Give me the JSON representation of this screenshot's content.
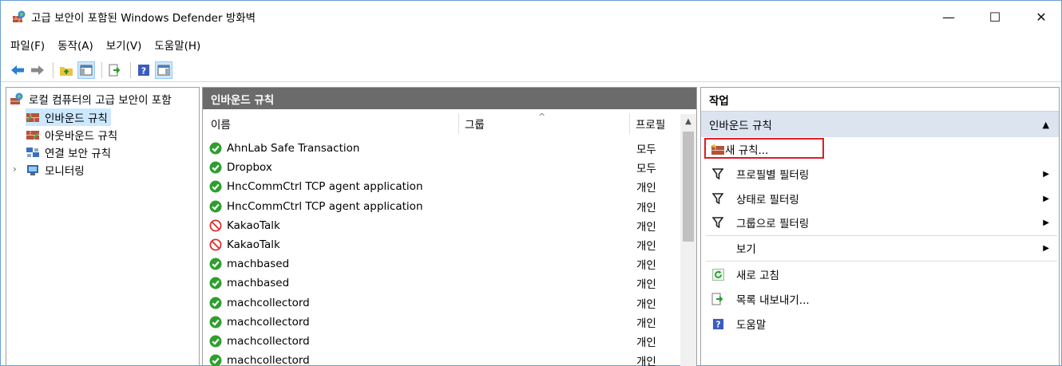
{
  "window": {
    "title": "고급 보안이 포함된 Windows Defender 방화벽",
    "minimize_glyph": "—",
    "maximize_glyph": "☐",
    "close_glyph": "✕"
  },
  "menu": {
    "items": [
      "파일(F)",
      "동작(A)",
      "보기(V)",
      "도움말(H)"
    ]
  },
  "toolbar": {
    "buttons": [
      "back-arrow-icon",
      "forward-arrow-icon",
      "up-folder-icon",
      "show-hide-tree-icon",
      "export-icon",
      "help-icon",
      "action-pane-icon"
    ]
  },
  "tree": {
    "root": "로컬 컴퓨터의 고급 보안이 포함",
    "items": [
      {
        "label": "인바운드 규칙",
        "selected": true
      },
      {
        "label": "아웃바운드 규칙",
        "selected": false
      },
      {
        "label": "연결 보안 규칙",
        "selected": false
      },
      {
        "label": "모니터링",
        "selected": false
      }
    ],
    "expander": "›"
  },
  "center": {
    "header": "인바운드 규칙",
    "columns": {
      "name": "이름",
      "group": "그룹",
      "profile": "프로필"
    },
    "sort_caret": "^",
    "rules": [
      {
        "name": "AhnLab Safe Transaction",
        "profile": "모두",
        "status": "allow"
      },
      {
        "name": "Dropbox",
        "profile": "모두",
        "status": "allow"
      },
      {
        "name": "HncCommCtrl TCP agent application",
        "profile": "개인",
        "status": "allow"
      },
      {
        "name": "HncCommCtrl TCP agent application",
        "profile": "개인",
        "status": "allow"
      },
      {
        "name": "KakaoTalk",
        "profile": "개인",
        "status": "block"
      },
      {
        "name": "KakaoTalk",
        "profile": "개인",
        "status": "block"
      },
      {
        "name": "machbased",
        "profile": "개인",
        "status": "allow"
      },
      {
        "name": "machbased",
        "profile": "개인",
        "status": "allow"
      },
      {
        "name": "machcollectord",
        "profile": "개인",
        "status": "allow"
      },
      {
        "name": "machcollectord",
        "profile": "개인",
        "status": "allow"
      },
      {
        "name": "machcollectord",
        "profile": "개인",
        "status": "allow"
      },
      {
        "name": "machcollectord",
        "profile": "개인",
        "status": "allow"
      }
    ]
  },
  "actions": {
    "header": "작업",
    "group": "인바운드 규칙",
    "collapse_glyph": "▲",
    "submenu_glyph": "▶",
    "items": {
      "new_rule": "새 규칙...",
      "filter_profile": "프로필별 필터링",
      "filter_state": "상태로 필터링",
      "filter_group": "그룹으로 필터링",
      "view": "보기",
      "refresh": "새로 고침",
      "export_list": "목록 내보내기...",
      "help": "도움말"
    }
  },
  "colors": {
    "center_header_bg": "#6b6b6b",
    "selected_bg": "#cce8ff",
    "actions_group_bg": "#dbe4ef",
    "highlight": "#e01b24",
    "allow_green": "#2e9e2e",
    "block_red": "#d9302c"
  }
}
